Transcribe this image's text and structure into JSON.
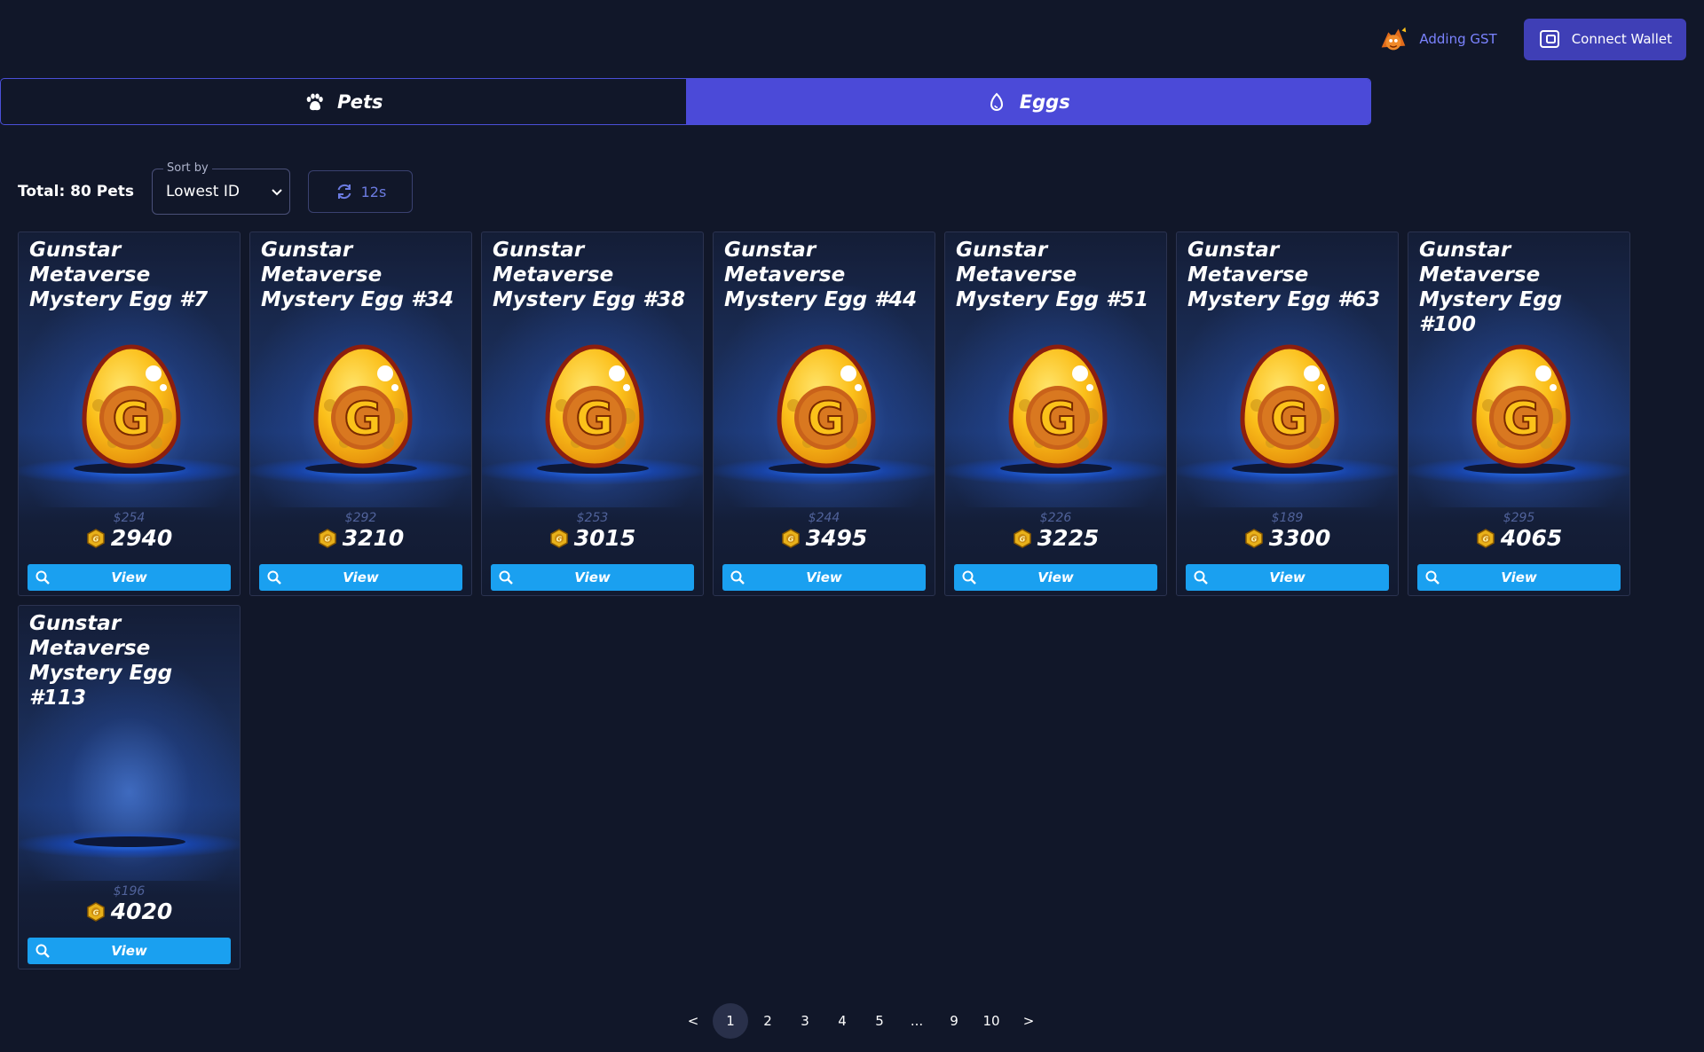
{
  "header": {
    "adding_gst_label": "Adding GST",
    "connect_wallet_label": "Connect Wallet"
  },
  "tabs": [
    {
      "label": "Pets",
      "icon": "paw-icon",
      "active": false
    },
    {
      "label": "Eggs",
      "icon": "egg-icon",
      "active": true
    }
  ],
  "filters": {
    "total_label": "Total: 80 Pets",
    "sort_legend": "Sort by",
    "sort_value": "Lowest ID",
    "refresh_label": "12s"
  },
  "cards": [
    {
      "title_line1": "Gunstar Metaverse",
      "title_line2": "Mystery Egg #7",
      "usd": "$254",
      "gst": "2940",
      "view_label": "View",
      "has_image": true
    },
    {
      "title_line1": "Gunstar Metaverse",
      "title_line2": "Mystery Egg #34",
      "usd": "$292",
      "gst": "3210",
      "view_label": "View",
      "has_image": true
    },
    {
      "title_line1": "Gunstar Metaverse",
      "title_line2": "Mystery Egg #38",
      "usd": "$253",
      "gst": "3015",
      "view_label": "View",
      "has_image": true
    },
    {
      "title_line1": "Gunstar Metaverse",
      "title_line2": "Mystery Egg #44",
      "usd": "$244",
      "gst": "3495",
      "view_label": "View",
      "has_image": true
    },
    {
      "title_line1": "Gunstar Metaverse",
      "title_line2": "Mystery Egg #51",
      "usd": "$226",
      "gst": "3225",
      "view_label": "View",
      "has_image": true
    },
    {
      "title_line1": "Gunstar Metaverse",
      "title_line2": "Mystery Egg #63",
      "usd": "$189",
      "gst": "3300",
      "view_label": "View",
      "has_image": true
    },
    {
      "title_line1": "Gunstar Metaverse",
      "title_line2": "Mystery Egg #100",
      "usd": "$295",
      "gst": "4065",
      "view_label": "View",
      "has_image": true
    },
    {
      "title_line1": "Gunstar Metaverse",
      "title_line2": "Mystery Egg #113",
      "usd": "$196",
      "gst": "4020",
      "view_label": "View",
      "has_image": false
    }
  ],
  "pagination": {
    "prev": "<",
    "pages": [
      "1",
      "2",
      "3",
      "4",
      "5",
      "...",
      "9",
      "10"
    ],
    "active": "1",
    "next": ">"
  },
  "colors": {
    "background": "#111729",
    "accent": "#4b4ad8",
    "view_button": "#1aa0f0",
    "usd_text": "#50629a"
  }
}
